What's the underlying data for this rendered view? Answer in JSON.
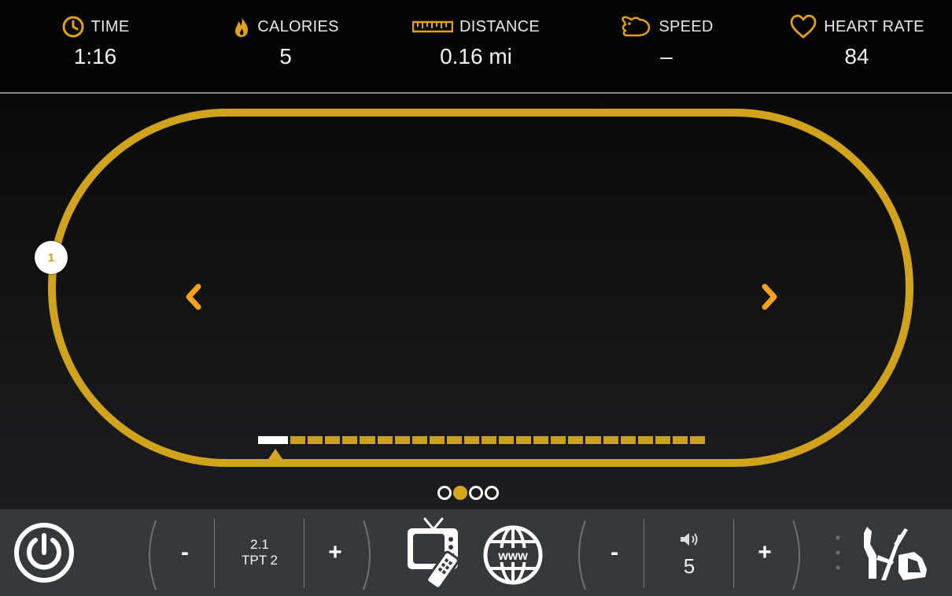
{
  "stats": [
    {
      "key": "time",
      "label": "TIME",
      "value": "1:16",
      "icon": "clock-icon"
    },
    {
      "key": "calories",
      "label": "CALORIES",
      "value": "5",
      "icon": "flame-icon"
    },
    {
      "key": "distance",
      "label": "DISTANCE",
      "value": "0.16 mi",
      "icon": "ruler-icon"
    },
    {
      "key": "speed",
      "label": "SPEED",
      "value": "–",
      "icon": "rabbit-icon"
    },
    {
      "key": "heart_rate",
      "label": "HEART RATE",
      "value": "84",
      "icon": "heart-icon"
    }
  ],
  "track": {
    "lane": "1",
    "segments_total": 25,
    "segments_done": 1,
    "color": "#d1a21c"
  },
  "pager": {
    "count": 4,
    "active": 1
  },
  "controls": {
    "program_minus": "-",
    "program_line1": "2.1",
    "program_line2": "TPT 2",
    "program_plus": "+",
    "volume_minus": "-",
    "volume_value": "5",
    "volume_plus": "+",
    "www_label": "www"
  },
  "colors": {
    "accent": "#d6a61c",
    "arrow": "#f4a21b",
    "stats_bg": "#050505",
    "controls_bg": "#35383c"
  }
}
